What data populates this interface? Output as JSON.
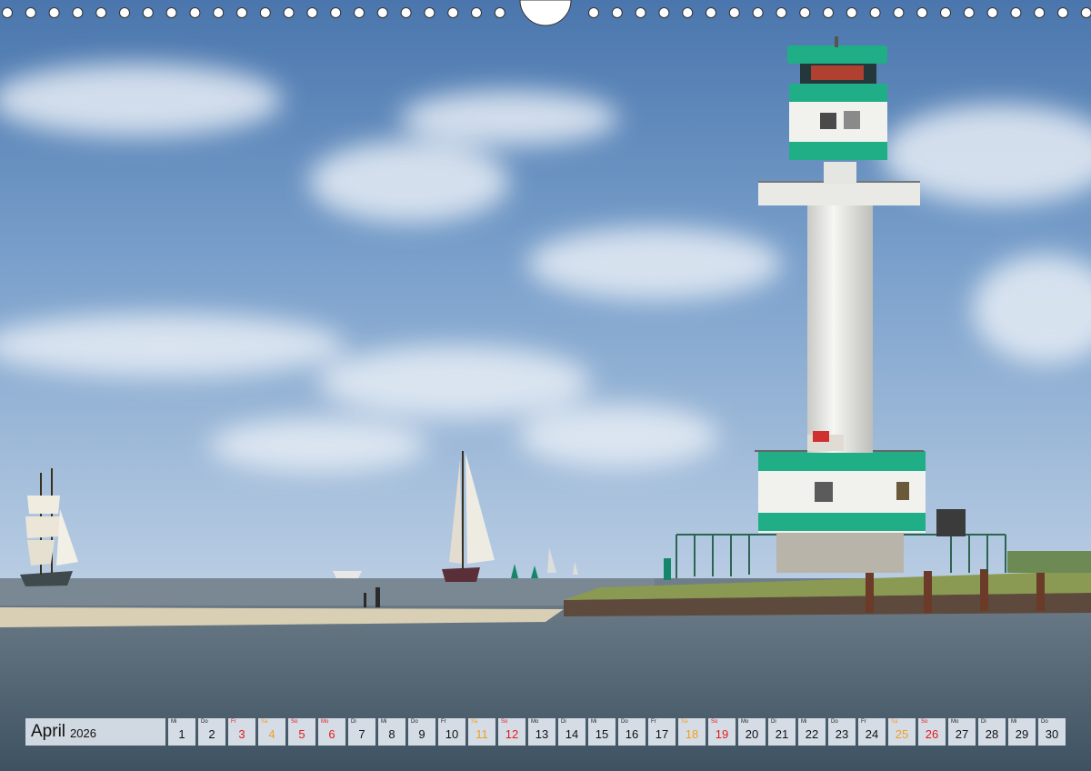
{
  "calendar": {
    "month": "April",
    "year": "2026",
    "days": [
      {
        "wd": "Mi",
        "d": "1",
        "t": "w"
      },
      {
        "wd": "Do",
        "d": "2",
        "t": "w"
      },
      {
        "wd": "Fr",
        "d": "3",
        "t": "hol"
      },
      {
        "wd": "Sa",
        "d": "4",
        "t": "sat"
      },
      {
        "wd": "So",
        "d": "5",
        "t": "sun"
      },
      {
        "wd": "Mo",
        "d": "6",
        "t": "hol"
      },
      {
        "wd": "Di",
        "d": "7",
        "t": "w"
      },
      {
        "wd": "Mi",
        "d": "8",
        "t": "w"
      },
      {
        "wd": "Do",
        "d": "9",
        "t": "w"
      },
      {
        "wd": "Fr",
        "d": "10",
        "t": "w"
      },
      {
        "wd": "Sa",
        "d": "11",
        "t": "sat"
      },
      {
        "wd": "So",
        "d": "12",
        "t": "sun"
      },
      {
        "wd": "Mo",
        "d": "13",
        "t": "w"
      },
      {
        "wd": "Di",
        "d": "14",
        "t": "w"
      },
      {
        "wd": "Mi",
        "d": "15",
        "t": "w"
      },
      {
        "wd": "Do",
        "d": "16",
        "t": "w"
      },
      {
        "wd": "Fr",
        "d": "17",
        "t": "w"
      },
      {
        "wd": "Sa",
        "d": "18",
        "t": "sat"
      },
      {
        "wd": "So",
        "d": "19",
        "t": "sun"
      },
      {
        "wd": "Mo",
        "d": "20",
        "t": "w"
      },
      {
        "wd": "Di",
        "d": "21",
        "t": "w"
      },
      {
        "wd": "Mi",
        "d": "22",
        "t": "w"
      },
      {
        "wd": "Do",
        "d": "23",
        "t": "w"
      },
      {
        "wd": "Fr",
        "d": "24",
        "t": "w"
      },
      {
        "wd": "Sa",
        "d": "25",
        "t": "sat"
      },
      {
        "wd": "So",
        "d": "26",
        "t": "sun"
      },
      {
        "wd": "Mo",
        "d": "27",
        "t": "w"
      },
      {
        "wd": "Di",
        "d": "28",
        "t": "w"
      },
      {
        "wd": "Mi",
        "d": "29",
        "t": "w"
      },
      {
        "wd": "Do",
        "d": "30",
        "t": "w"
      }
    ]
  },
  "colors": {
    "sky": "#6f98c4",
    "sea": "#566a7a",
    "lighthouse_green": "#1fae86",
    "lighthouse_white": "#f1f1ee",
    "sunday_red": "#e31b1b",
    "saturday_orange": "#f0a020"
  }
}
